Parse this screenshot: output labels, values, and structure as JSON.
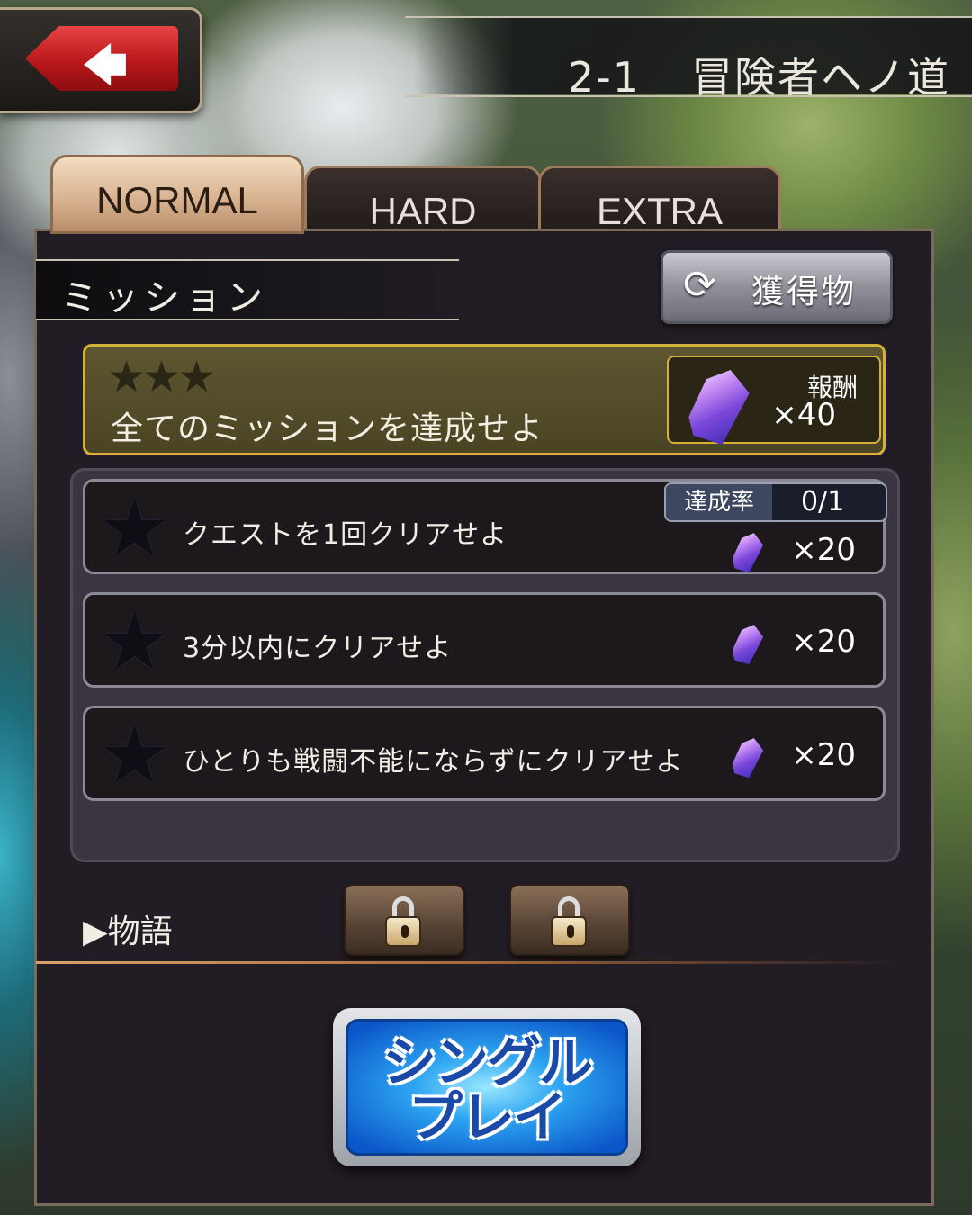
{
  "header": {
    "back_icon": "arrow-left-icon",
    "stage_number": "2-1",
    "stage_title": "冒険者ヘノ道"
  },
  "tabs": [
    {
      "label": "NORMAL",
      "active": true
    },
    {
      "label": "HARD",
      "active": false
    },
    {
      "label": "EXTRA",
      "active": false
    }
  ],
  "mission_section": {
    "title": "ミッション",
    "rewards_button": "獲得物",
    "rewards_icon": "refresh-icon"
  },
  "complete_all": {
    "stars": "★★★",
    "text": "全てのミッションを達成せよ",
    "reward_label": "報酬",
    "reward_count": "×40"
  },
  "progress": {
    "label": "達成率",
    "value": "0/1"
  },
  "missions": [
    {
      "text": "クエストを1回クリアせよ",
      "reward": "×20"
    },
    {
      "text": "3分以内にクリアせよ",
      "reward": "×20"
    },
    {
      "text": "ひとりも戦闘不能にならずにクリアせよ",
      "reward": "×20"
    }
  ],
  "story": {
    "label": "▶物語",
    "locked_slots": 2
  },
  "play_button": {
    "line1": "シングル",
    "line2": "プレイ"
  },
  "colors": {
    "gold_border": "#d7b03a",
    "play_blue": "#2ea6f2",
    "back_red": "#c81e21"
  }
}
